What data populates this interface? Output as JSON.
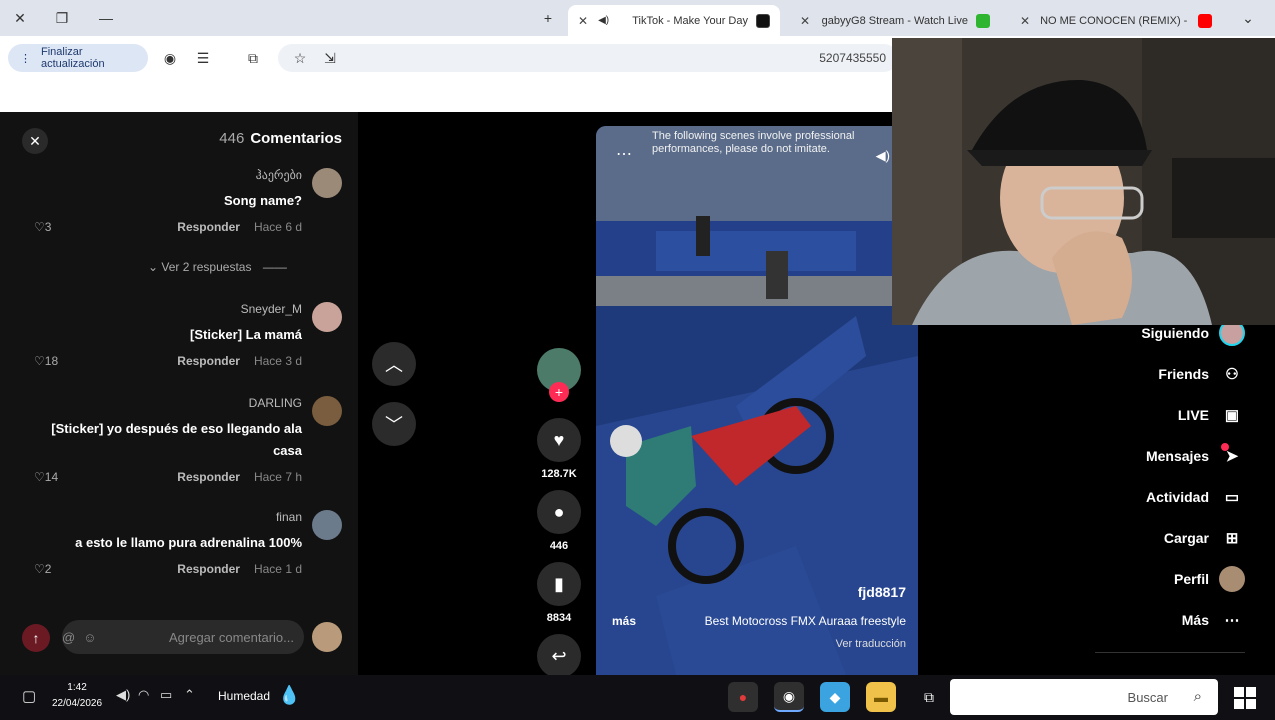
{
  "browser": {
    "tabs": [
      {
        "title": "NO ME CONOCEN (REMIX) - B",
        "color": "#ff0000"
      },
      {
        "title": "gabyyG8 Stream - Watch Live",
        "color": "#2fb52f"
      },
      {
        "title": "TikTok - Make Your Day",
        "color": "#111111"
      }
    ],
    "new_tab": "+",
    "update_button": "Finalizar actualización",
    "url_fragment": "5207435550"
  },
  "comments": {
    "title": "Comentarios",
    "count": "446",
    "items": [
      {
        "user": "ჰაერები",
        "text": "Song name?",
        "time": "Hace 6 d",
        "reply": "Responder",
        "likes": "3",
        "avatar_color": "#9c8a78"
      },
      {
        "user": "Sneyder_M",
        "text": "[Sticker] La mamá",
        "time": "Hace 3 d",
        "reply": "Responder",
        "likes": "18",
        "avatar_color": "#c9a39a"
      },
      {
        "user": "DARLING",
        "text": "[Sticker] yo después de eso llegando ala casa",
        "time": "Hace 7 h",
        "reply": "Responder",
        "likes": "14",
        "avatar_color": "#7a5c3e"
      },
      {
        "user": "finan",
        "text": "a esto le llamo pura adrenalina 100%",
        "time": "Hace 1 d",
        "reply": "Responder",
        "likes": "2",
        "avatar_color": "#6b7b8c"
      }
    ],
    "view_replies": "Ver 2 respuestas",
    "input_placeholder": "Agregar comentario..."
  },
  "actions": {
    "likes": "128.7K",
    "comments": "446",
    "saves": "8834"
  },
  "video": {
    "top_text": "The following scenes involve professional performances, please do not imitate.",
    "author": "fjd8817",
    "description": "Best Motocross FMX Auraaa freestyle",
    "more": "más",
    "translate": "Ver traducción"
  },
  "sidebar": {
    "items": [
      {
        "label": "Siguiendo",
        "icon": "avatar"
      },
      {
        "label": "Friends",
        "icon": "friends-icon"
      },
      {
        "label": "LIVE",
        "icon": "live-icon"
      },
      {
        "label": "Mensajes",
        "icon": "messages-icon"
      },
      {
        "label": "Actividad",
        "icon": "activity-icon"
      },
      {
        "label": "Cargar",
        "icon": "upload-icon"
      },
      {
        "label": "Perfil",
        "icon": "avatar"
      },
      {
        "label": "Más",
        "icon": "more-icon"
      }
    ]
  },
  "taskbar": {
    "search": "Buscar",
    "weather": "Humedad",
    "time": "1:42",
    "date": "22/04/2026"
  }
}
